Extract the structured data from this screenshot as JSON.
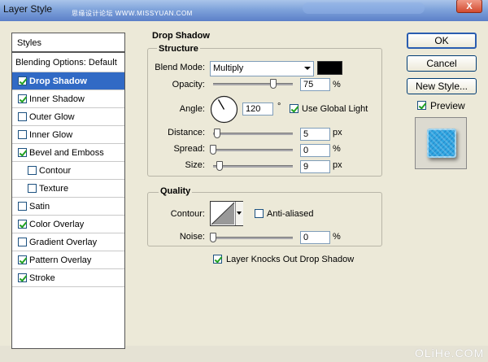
{
  "window": {
    "title": "Layer Style",
    "watermark": "思缘设计论坛  WWW.MISSYUAN.COM",
    "close_glyph": "X"
  },
  "styles_list": {
    "header": "Styles",
    "blending": "Blending Options: Default",
    "items": [
      {
        "label": "Drop Shadow",
        "checked": true,
        "selected": true,
        "indent": false
      },
      {
        "label": "Inner Shadow",
        "checked": true,
        "selected": false,
        "indent": false
      },
      {
        "label": "Outer Glow",
        "checked": false,
        "selected": false,
        "indent": false
      },
      {
        "label": "Inner Glow",
        "checked": false,
        "selected": false,
        "indent": false
      },
      {
        "label": "Bevel and Emboss",
        "checked": true,
        "selected": false,
        "indent": false
      },
      {
        "label": "Contour",
        "checked": false,
        "selected": false,
        "indent": true
      },
      {
        "label": "Texture",
        "checked": false,
        "selected": false,
        "indent": true
      },
      {
        "label": "Satin",
        "checked": false,
        "selected": false,
        "indent": false
      },
      {
        "label": "Color Overlay",
        "checked": true,
        "selected": false,
        "indent": false
      },
      {
        "label": "Gradient Overlay",
        "checked": false,
        "selected": false,
        "indent": false
      },
      {
        "label": "Pattern Overlay",
        "checked": true,
        "selected": false,
        "indent": false
      },
      {
        "label": "Stroke",
        "checked": true,
        "selected": false,
        "indent": false
      }
    ]
  },
  "drop_shadow": {
    "section_title": "Drop Shadow",
    "structure_title": "Structure",
    "blend_mode_label": "Blend Mode:",
    "blend_mode_value": "Multiply",
    "shadow_color": "#000000",
    "opacity_label": "Opacity:",
    "opacity_value": "75",
    "opacity_unit": "%",
    "angle_label": "Angle:",
    "angle_value": "120",
    "angle_unit": "°",
    "use_global_light_label": "Use Global Light",
    "use_global_light_checked": true,
    "distance_label": "Distance:",
    "distance_value": "5",
    "distance_unit": "px",
    "spread_label": "Spread:",
    "spread_value": "0",
    "spread_unit": "%",
    "size_label": "Size:",
    "size_value": "9",
    "size_unit": "px",
    "quality_title": "Quality",
    "contour_label": "Contour:",
    "anti_aliased_label": "Anti-aliased",
    "anti_aliased_checked": false,
    "noise_label": "Noise:",
    "noise_value": "0",
    "noise_unit": "%",
    "knockout_label": "Layer Knocks Out Drop Shadow",
    "knockout_checked": true
  },
  "buttons": {
    "ok": "OK",
    "cancel": "Cancel",
    "new_style": "New Style...",
    "preview_label": "Preview",
    "preview_checked": true
  },
  "footer": {
    "mark": "OLiHe.COM"
  },
  "colors": {
    "selection": "#316ac5",
    "preview_swatch": "#2ea4e0",
    "dialog_bg": "#ece9d8"
  }
}
